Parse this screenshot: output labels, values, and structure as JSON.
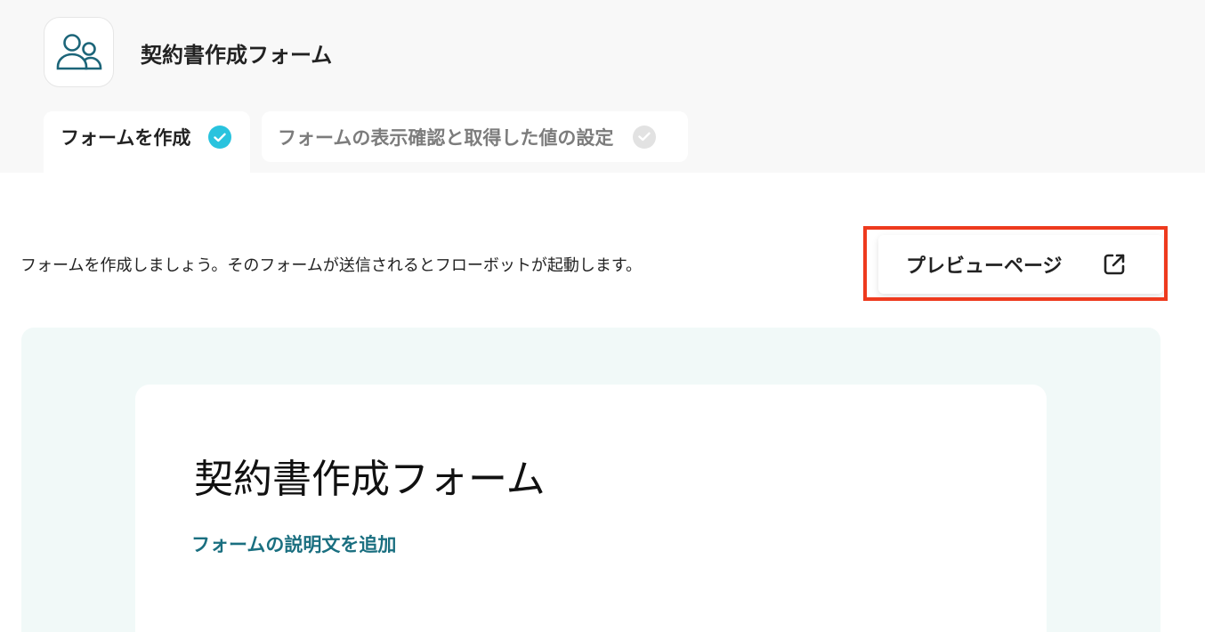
{
  "app": {
    "title": "契約書作成フォーム",
    "icon": "users-icon"
  },
  "tabs": [
    {
      "label": "フォームを作成",
      "state": "completed"
    },
    {
      "label": "フォームの表示確認と取得した値の設定",
      "state": "pending"
    }
  ],
  "intro_text": "フォームを作成しましょう。そのフォームが送信されるとフローボットが起動します。",
  "preview_button": {
    "label": "プレビューページ",
    "icon": "external-link-icon"
  },
  "form": {
    "title": "契約書作成フォーム",
    "add_description_label": "フォームの説明文を追加"
  },
  "colors": {
    "accent": "#29c3de",
    "link": "#1a6f80",
    "highlight": "#ee3a1e",
    "canvas_bg": "#f1f9f8",
    "icon_teal": "#1c6579"
  }
}
